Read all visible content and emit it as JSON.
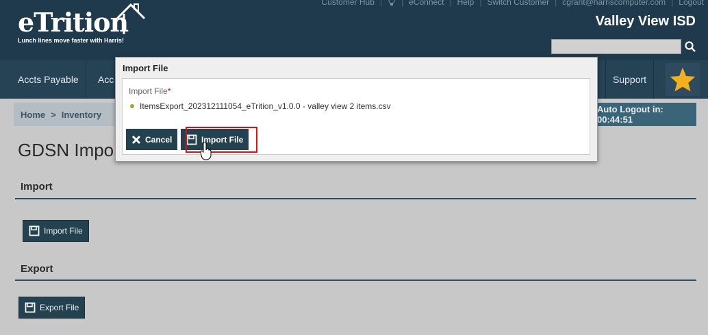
{
  "header": {
    "logo_text": "eTrition",
    "tagline": "Lunch lines move faster with Harris!",
    "top_links": [
      "Customer Hub",
      "eConnect",
      "Help",
      "Switch Customer",
      "cgrant@harriscomputer.com",
      "Logout"
    ],
    "district": "Valley View ISD",
    "search_value": ""
  },
  "nav": {
    "items": [
      "Accts Payable",
      "Acc",
      "Support"
    ]
  },
  "breadcrumb": {
    "home": "Home",
    "sep": ">",
    "current": "Inventory"
  },
  "autologout": "Auto Logout in: 00:44:51",
  "page": {
    "title": "GDSN Impo",
    "import_section": "Import",
    "import_button": "Import File",
    "export_section": "Export",
    "export_button": "Export File"
  },
  "modal": {
    "title": "Import File",
    "field_label": "Import File",
    "required_mark": "*",
    "file_name": "ItemsExport_202312111054_eTrition_v1.0.0 - valley view 2 items.csv",
    "cancel_label": "Cancel",
    "import_label": "Import File"
  },
  "colors": {
    "header_bg": "#1e3a4c",
    "nav_bg": "#264255",
    "button_bg": "#24414f",
    "highlight": "#d11111",
    "star": "#f2b01e"
  }
}
